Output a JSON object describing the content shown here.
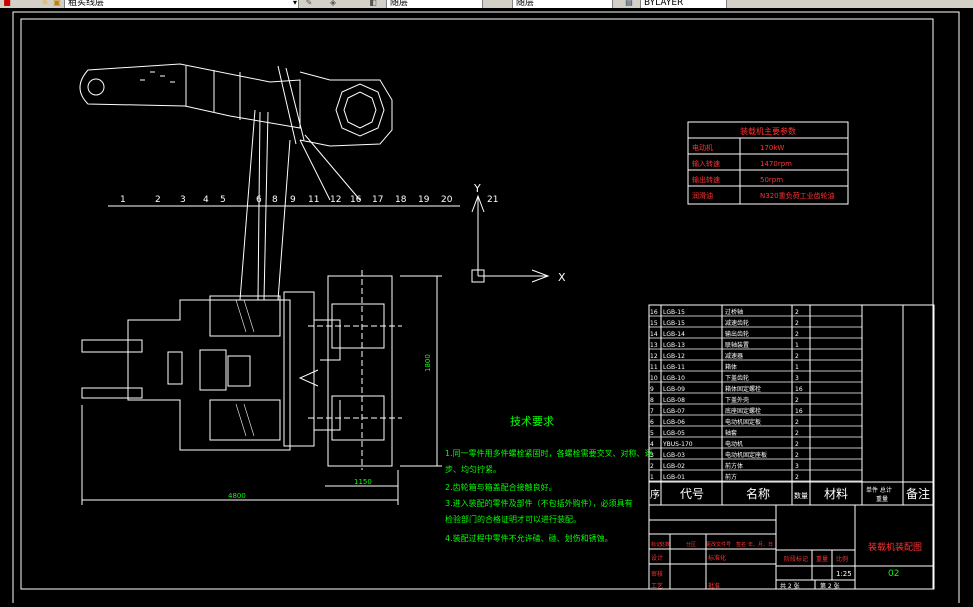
{
  "toolbar": {
    "layer_value": "粗实线层",
    "linetype_value": "随层",
    "lineweight_value": "随层",
    "color_value": "BYLAYER"
  },
  "params_table": {
    "title": "装载机主要参数",
    "rows": [
      {
        "label": "电动机",
        "value": "170kW"
      },
      {
        "label": "输入转速",
        "value": "1470rpm"
      },
      {
        "label": "输出转速",
        "value": "50rpm"
      },
      {
        "label": "润滑油",
        "value": "N320重负荷工业齿轮油"
      }
    ]
  },
  "leaders": [
    "1",
    "2",
    "3",
    "4",
    "5",
    "6",
    "8",
    "9",
    "11",
    "12",
    "16",
    "17",
    "18",
    "19",
    "20",
    "21"
  ],
  "dimensions": {
    "width": "4800",
    "small": "1150",
    "height": "1800"
  },
  "axis": {
    "y": "Y",
    "x": "X"
  },
  "tech_req": {
    "title": "技术要求",
    "lines": [
      "1.同一零件用多件螺栓紧固时，各螺栓需要交叉、对称、逐",
      "步、均匀拧紧。",
      "2.齿轮箱与箱盖配合接触良好。",
      "3.进入装配的零件及部件（不包括外购件），必须具有",
      "检验部门的合格证明才可以进行装配。",
      "4.装配过程中零件不允许磕、碰、划伤和锈蚀。"
    ]
  },
  "parts": {
    "rows": [
      {
        "no": "16",
        "code": "LGB-15",
        "name": "过桥轴",
        "qty": "2"
      },
      {
        "no": "15",
        "code": "LGB-15",
        "name": "减速齿轮",
        "qty": "2"
      },
      {
        "no": "14",
        "code": "LGB-14",
        "name": "输出齿轮",
        "qty": "2"
      },
      {
        "no": "13",
        "code": "LGB-13",
        "name": "联轴装置",
        "qty": "1"
      },
      {
        "no": "12",
        "code": "LGB-12",
        "name": "减速器",
        "qty": "2"
      },
      {
        "no": "11",
        "code": "LGB-11",
        "name": "箱体",
        "qty": "1"
      },
      {
        "no": "10",
        "code": "LGB-10",
        "name": "下盖齿轮",
        "qty": "3"
      },
      {
        "no": "9",
        "code": "LGB-09",
        "name": "箱体固定螺栓",
        "qty": "16"
      },
      {
        "no": "8",
        "code": "LGB-08",
        "name": "下盖外壳",
        "qty": "2"
      },
      {
        "no": "7",
        "code": "LGB-07",
        "name": "底座固定螺栓",
        "qty": "16"
      },
      {
        "no": "6",
        "code": "LGB-06",
        "name": "电动机固定板",
        "qty": "2"
      },
      {
        "no": "5",
        "code": "LGB-05",
        "name": "轴套",
        "qty": "2"
      },
      {
        "no": "4",
        "code": "YBUS-170",
        "name": "电动机",
        "qty": "2"
      },
      {
        "no": "3",
        "code": "LGB-03",
        "name": "电动机固定座板",
        "qty": "2"
      },
      {
        "no": "2",
        "code": "LGB-02",
        "name": "前方体",
        "qty": "3"
      },
      {
        "no": "1",
        "code": "LGB-01",
        "name": "前方",
        "qty": "2"
      }
    ],
    "header": {
      "no": "序",
      "code": "代号",
      "name": "名称",
      "qty": "数量",
      "material": "材料",
      "weight": "单件 总计",
      "weight2": "重量",
      "note": "备注"
    }
  },
  "title_block": {
    "drawing_name": "装载机装配图",
    "drawing_no": "02",
    "scale": "1:25",
    "sheet_total": "共 2 张",
    "sheet_no": "第 2 张",
    "marks": [
      "标记",
      "处数",
      "分区",
      "更改文件号",
      "签名",
      "年、月、日"
    ],
    "roles": [
      "设计",
      "审核",
      "工艺",
      "标准化",
      "批准"
    ],
    "stage": "阶段标记",
    "weight": "重量",
    "ratio": "比例"
  }
}
